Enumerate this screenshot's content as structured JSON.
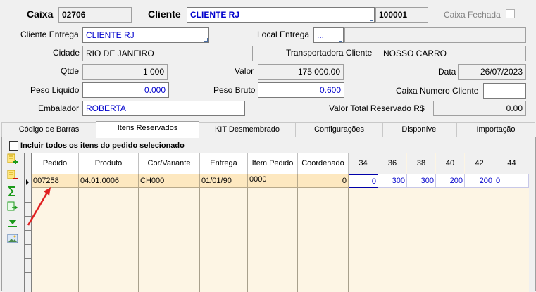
{
  "header": {
    "caixa_label": "Caixa",
    "caixa_value": "02706",
    "cliente_label": "Cliente",
    "cliente_value": "CLIENTE RJ",
    "cliente_code": "100001",
    "caixa_fechada_label": "Caixa Fechada"
  },
  "form": {
    "cliente_entrega_label": "Cliente Entrega",
    "cliente_entrega_value": "CLIENTE RJ",
    "local_entrega_label": "Local Entrega",
    "local_entrega_value": "...",
    "local_entrega_desc": "",
    "cidade_label": "Cidade",
    "cidade_value": "RIO DE JANEIRO",
    "transportadora_label": "Transportadora Cliente",
    "transportadora_value": "NOSSO CARRO",
    "qtde_label": "Qtde",
    "qtde_value": "1 000",
    "valor_label": "Valor",
    "valor_value": "175 000.00",
    "data_label": "Data",
    "data_value": "26/07/2023",
    "peso_liquido_label": "Peso Liquido",
    "peso_liquido_value": "0.000",
    "peso_bruto_label": "Peso Bruto",
    "peso_bruto_value": "0.600",
    "caixa_numero_cliente_label": "Caixa Numero Cliente",
    "caixa_numero_cliente_value": "",
    "embalador_label": "Embalador",
    "embalador_value": "ROBERTA",
    "valor_total_label": "Valor Total Reservado R$",
    "valor_total_value": "0.00"
  },
  "tabs": [
    {
      "label": "Código de Barras"
    },
    {
      "label": "Itens Reservados"
    },
    {
      "label": "KIT Desmembrado"
    },
    {
      "label": "Configurações"
    },
    {
      "label": "Disponível"
    },
    {
      "label": "Importação"
    }
  ],
  "include_all_label": "Incluir todos os itens do pedido selecionado",
  "grid": {
    "columns": [
      "Pedido",
      "Produto",
      "Cor/Variante",
      "Entrega",
      "Item Pedido",
      "Coordenado",
      "34",
      "36",
      "38",
      "40",
      "42",
      "44"
    ],
    "row": {
      "pedido": "007258",
      "produto": "04.01.0006",
      "cor": "CH000",
      "entrega": "01/01/90",
      "item_pedido": "0000",
      "coordenado": "0",
      "s34": "0",
      "s36": "300",
      "s38": "300",
      "s40": "200",
      "s42": "200",
      "s44": "0"
    }
  },
  "toolbar_icons": [
    "add-item-icon",
    "remove-item-icon",
    "sum-icon",
    "export-icon",
    "move-down-icon",
    "image-icon"
  ],
  "colors": {
    "accent_text": "#0000cc",
    "row_highlight": "#fde8c0",
    "grid_bg": "#fdf5e4",
    "arrow": "#e02020"
  }
}
